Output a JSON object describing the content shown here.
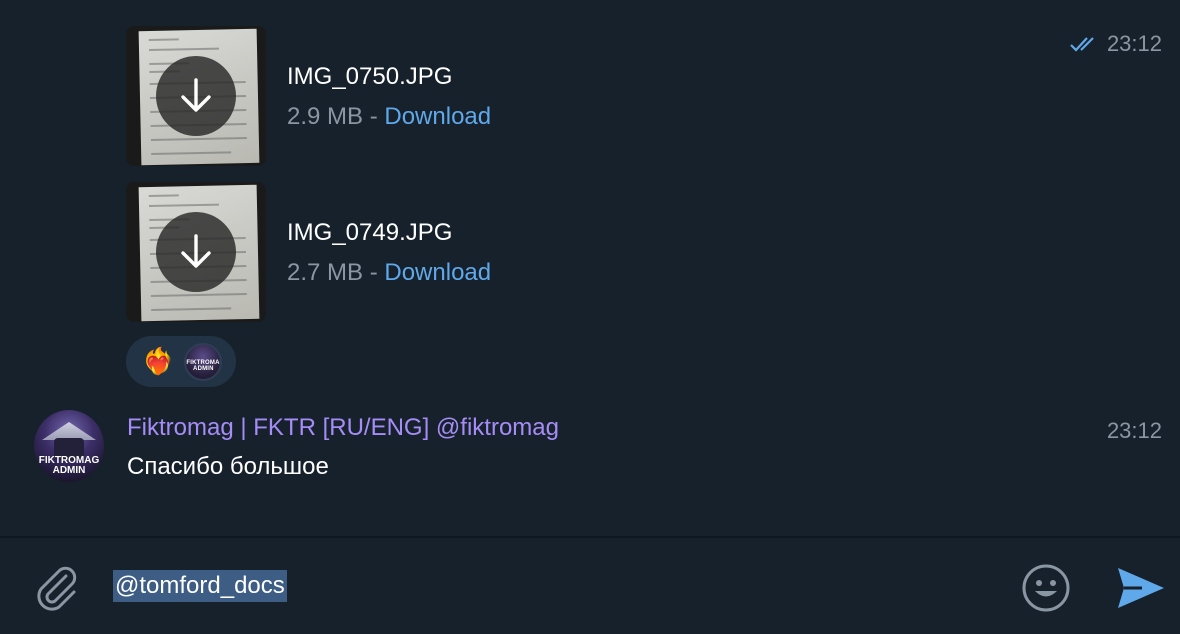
{
  "files": [
    {
      "name": "IMG_0750.JPG",
      "size": "2.9 MB",
      "separator": "-",
      "action": "Download"
    },
    {
      "name": "IMG_0749.JPG",
      "size": "2.7 MB",
      "separator": "-",
      "action": "Download"
    }
  ],
  "file_message_time": "23:12",
  "reactions": {
    "emoji": "❤️‍🔥",
    "avatar_text": "FIKTROMAG ADMIN"
  },
  "message": {
    "sender": "Fiktromag | FKTR [RU/ENG] @fiktromag",
    "text": "Спасибо большое",
    "time": "23:12",
    "avatar_text": "FIKTROMAG ADMIN"
  },
  "composer": {
    "value": "@tomford_docs"
  },
  "colors": {
    "background": "#17212b",
    "accent": "#5fa8ea",
    "sender": "#a58cf7",
    "muted": "#8a96a3",
    "selection": "#3e5d84"
  },
  "icons": [
    "read-checkmarks-icon",
    "download-arrow-icon",
    "attach-paperclip-icon",
    "emoji-smile-icon",
    "send-icon"
  ]
}
